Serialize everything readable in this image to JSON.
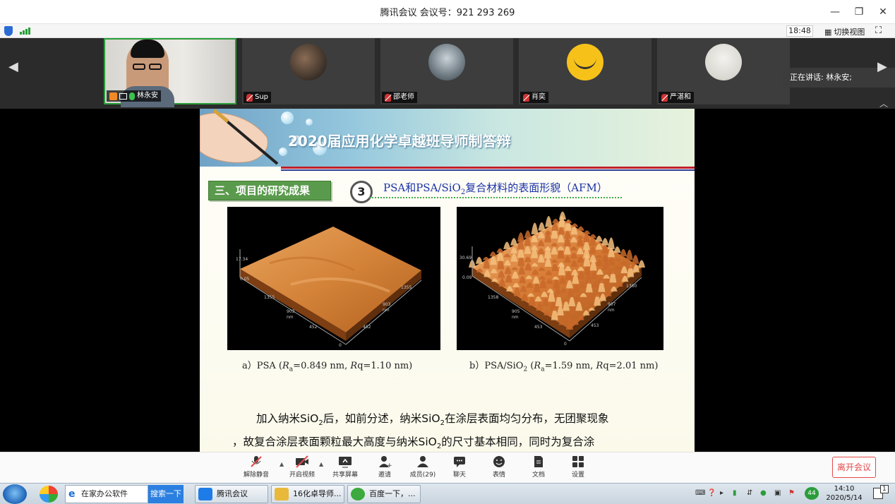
{
  "window": {
    "title": "腾讯会议 会议号：921 293 269"
  },
  "infobar": {
    "time": "18:48",
    "switch_view": "切换视图"
  },
  "participants": [
    {
      "name": "林永安",
      "self": true
    },
    {
      "name": "Sup"
    },
    {
      "name": "邵老师"
    },
    {
      "name": "肖奕"
    },
    {
      "name": "严湛和"
    }
  ],
  "speaking": {
    "label": "正在讲话: 林永安;"
  },
  "slide": {
    "header": "2020届应用化学卓越班导师制答辩",
    "section": "三、项目的研究成果",
    "badge": "3",
    "subtitle_pre": "PSA和PSA/SiO",
    "subtitle_sub": "2",
    "subtitle_post": "复合材料的表面形貌（AFM）",
    "afm_a": {
      "zmax": "17.34",
      "z0": "0.05",
      "x1": "1355",
      "x2": "903",
      "x3": "452",
      "y1": "1355",
      "y2": "903",
      "y3": "452",
      "unit": "nm",
      "origin": "0"
    },
    "afm_b": {
      "zmax": "30.69",
      "z0": "0.09",
      "x1": "1360",
      "x2": "907",
      "x3": "453",
      "y1": "1358",
      "y2": "905",
      "y3": "453",
      "unit": "nm",
      "origin": "0"
    },
    "caption_a": {
      "pre": "a）PSA (",
      "ra": "R",
      "ra_sub": "a",
      "post": "=0.849 nm, ",
      "rq": "R",
      "rq_post": "q=1.10 nm)"
    },
    "caption_b": {
      "pre": "b）PSA/SiO",
      "sio_sub": "2",
      "mid": " (",
      "ra": "R",
      "ra_sub": "a",
      "post": "=1.59 nm, ",
      "rq": "R",
      "rq_post": "q=2.01 nm)"
    },
    "para1": {
      "a": "加入纳米SiO",
      "s1": "2",
      "b": "后，如前分述，纳米SiO",
      "s2": "2",
      "c": "在涂层表面均匀分布，无团聚现象"
    },
    "para2": {
      "a": "，故复合涂层表面颗粒最大高度与纳米SiO",
      "s1": "2",
      "b": "的尺寸基本相同，同时为复合涂"
    }
  },
  "toolbar": {
    "unmute": "解除静音",
    "video": "开启视频",
    "share": "共享屏幕",
    "invite": "邀请",
    "members": "成员(29)",
    "chat": "聊天",
    "emoji": "表情",
    "docs": "文档",
    "settings": "设置",
    "leave": "离开会议"
  },
  "taskbar": {
    "search_text": "在家办公软件",
    "search_btn": "搜索一下",
    "apps": [
      "腾讯会议",
      "16化卓导师...",
      "百度一下，..."
    ],
    "tray_badge": "44",
    "time": "14:10",
    "date": "2020/5/14",
    "notify_count": "1"
  },
  "colors": {
    "accent_green": "#2a9d3a",
    "leave_red": "#e24b4b",
    "subtitle_blue": "#1a32a8",
    "section_green": "#5a9a4c"
  }
}
